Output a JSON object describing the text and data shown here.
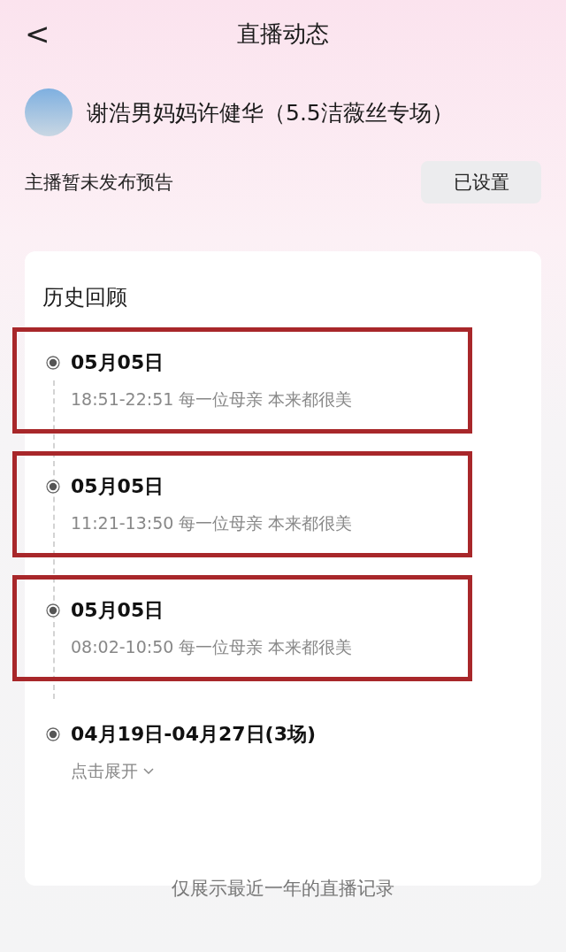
{
  "header": {
    "back": "<",
    "title": "直播动态"
  },
  "streamer": {
    "name": "谢浩男妈妈许健华（5.5洁薇丝专场）"
  },
  "preview": {
    "text": "主播暂未发布预告",
    "button": "已设置"
  },
  "history": {
    "title": "历史回顾",
    "entries": [
      {
        "kind": "session",
        "date": "05月05日",
        "detail": "18:51-22:51 每一位母亲 本来都很美",
        "highlighted": true
      },
      {
        "kind": "session",
        "date": "05月05日",
        "detail": "11:21-13:50 每一位母亲 本来都很美",
        "highlighted": true
      },
      {
        "kind": "session",
        "date": "05月05日",
        "detail": "08:02-10:50 每一位母亲 本来都很美",
        "highlighted": true
      },
      {
        "kind": "group",
        "date": "04月19日-04月27日(3场)",
        "detail": "点击展开",
        "highlighted": false
      }
    ],
    "footer": "仅展示最近一年的直播记录"
  }
}
